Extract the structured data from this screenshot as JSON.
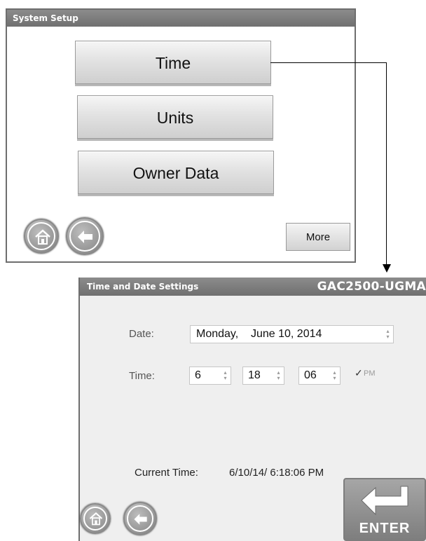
{
  "system_setup": {
    "title": "System Setup",
    "buttons": {
      "time": "Time",
      "units": "Units",
      "owner_data": "Owner Data",
      "more": "More"
    }
  },
  "time_settings": {
    "title": "Time and Date Settings",
    "model": "GAC2500-UGMA",
    "date_label": "Date:",
    "date_value": "Monday,    June 10, 2014",
    "time_label": "Time:",
    "hour": "6",
    "minute": "18",
    "second": "06",
    "pm_check": "✓",
    "pm_label": "PM",
    "current_time_label": "Current Time:",
    "current_time_value": "6/10/14/ 6:18:06 PM",
    "enter_label": "ENTER"
  },
  "icons": {
    "home": "home-icon",
    "back": "back-arrow-icon",
    "enter": "enter-arrow-icon",
    "spinner": "spinner-arrows-icon",
    "dropdown": "dropdown-arrow-icon"
  }
}
